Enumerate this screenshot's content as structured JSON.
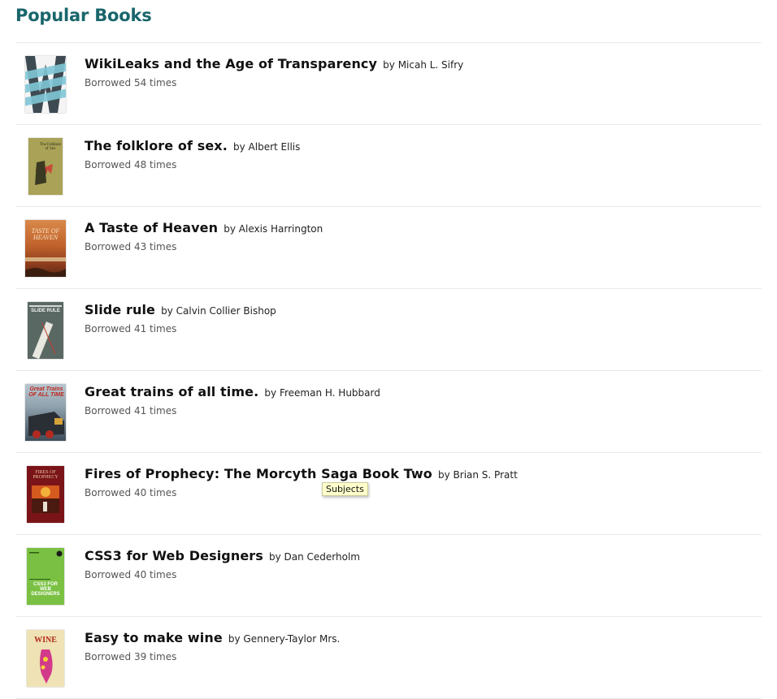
{
  "page": {
    "title": "Popular Books"
  },
  "books": [
    {
      "title": "WikiLeaks and the Age of Transparency",
      "by": "by",
      "author": "Micah L. Sifry",
      "borrowed": "Borrowed 54 times",
      "cover_text": "W"
    },
    {
      "title": "The folklore of sex.",
      "by": "by",
      "author": "Albert Ellis",
      "borrowed": "Borrowed 48 times",
      "cover_text": "The Folklore of Sex"
    },
    {
      "title": "A Taste of Heaven",
      "by": "by",
      "author": "Alexis Harrington",
      "borrowed": "Borrowed 43 times",
      "cover_text": "TASTE OF HEAVEN"
    },
    {
      "title": "Slide rule",
      "by": "by",
      "author": "Calvin Collier Bishop",
      "borrowed": "Borrowed 41 times",
      "cover_text": "SLIDE RULE"
    },
    {
      "title": "Great trains of all time.",
      "by": "by",
      "author": "Freeman H. Hubbard",
      "borrowed": "Borrowed 41 times",
      "cover_text": "Great Trains OF ALL TIME"
    },
    {
      "title": "Fires of Prophecy: The Morcyth Saga Book Two",
      "by": "by",
      "author": "Brian S. Pratt",
      "borrowed": "Borrowed 40 times",
      "cover_text": "FIRES OF PROPHECY"
    },
    {
      "title": "CSS3 for Web Designers",
      "by": "by",
      "author": "Dan Cederholm",
      "borrowed": "Borrowed 40 times",
      "cover_text": "CSS3 FOR WEB DESIGNERS"
    },
    {
      "title": "Easy to make wine",
      "by": "by",
      "author": "Gennery-Taylor Mrs.",
      "borrowed": "Borrowed 39 times",
      "cover_text": "WINE"
    }
  ],
  "tooltip": {
    "text": "Subjects"
  }
}
